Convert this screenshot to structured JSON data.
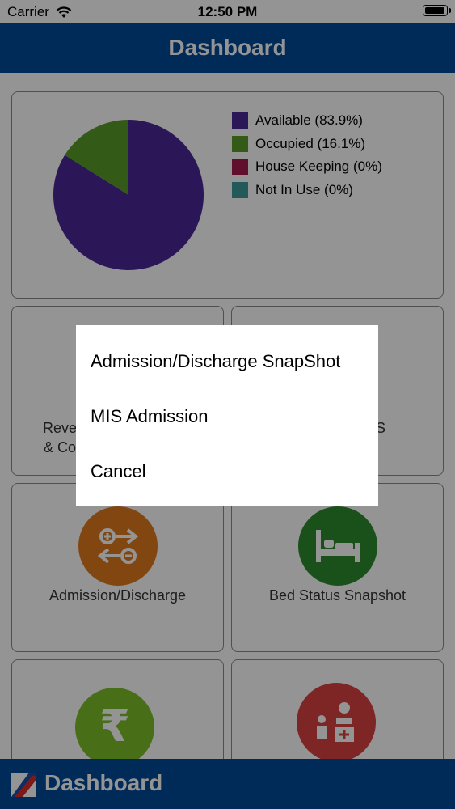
{
  "status_bar": {
    "carrier": "Carrier",
    "time": "12:50 PM",
    "battery_level": 1.0
  },
  "header": {
    "title": "Dashboard"
  },
  "bed_chart": {
    "chart_data": {
      "type": "pie",
      "slices": [
        {
          "label": "Available (83.9%)",
          "value": 83.9,
          "color": "#4b2896"
        },
        {
          "label": "Occupied (16.1%)",
          "value": 16.1,
          "color": "#5b9b2a"
        },
        {
          "label": "House Keeping (0%)",
          "value": 0,
          "color": "#a51c4c"
        },
        {
          "label": "Not In Use (0%)",
          "value": 0,
          "color": "#3f9a9a"
        }
      ],
      "legend_position": "right"
    }
  },
  "tiles": {
    "revenue_partial": {
      "line1": "Reve",
      "line2": "& Co"
    },
    "mis_partial": {
      "text": "S"
    },
    "admission_discharge": {
      "label": "Admission/Discharge",
      "icon": "admission-discharge-icon",
      "color": "#e07a1e"
    },
    "bed_status": {
      "label": "Bed Status Snapshot",
      "icon": "bed-icon",
      "color": "#2e8b2e"
    },
    "revenue": {
      "icon": "rupee-icon",
      "color": "#7cbf2a"
    },
    "doctor": {
      "icon": "doctor-consult-icon",
      "color": "#d94040"
    }
  },
  "action_sheet": {
    "options": [
      "Admission/Discharge SnapShot",
      "MIS Admission",
      "Cancel"
    ]
  },
  "tab_bar": {
    "title": "Dashboard"
  },
  "colors": {
    "brand": "#004a99"
  }
}
